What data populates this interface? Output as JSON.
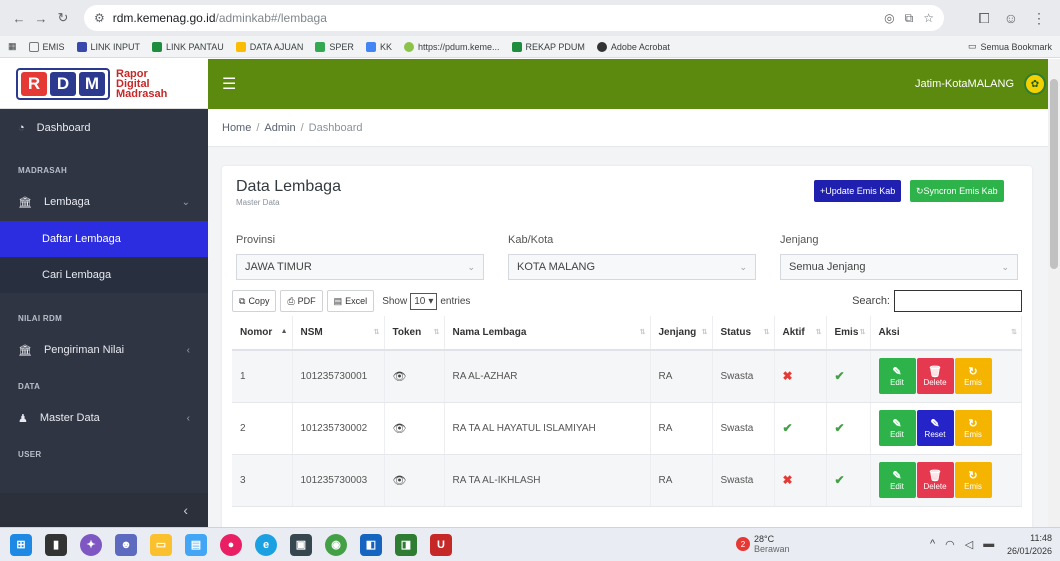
{
  "browser": {
    "url_host": "rdm.kemenag.go.id",
    "url_path": "/adminkab#/lembaga",
    "bookmarks": [
      "EMIS",
      "LINK INPUT",
      "LINK PANTAU",
      "DATA AJUAN",
      "SPER",
      "KK",
      "https://pdum.keme...",
      "REKAP PDUM",
      "Adobe Acrobat"
    ],
    "bookmarks_all": "Semua Bookmark"
  },
  "logo": {
    "line1": "Rapor",
    "line2": "Digital",
    "line3": "Madrasah",
    "mark": [
      "R",
      "D",
      "M"
    ]
  },
  "header": {
    "user": "Jatim-KotaMALANG"
  },
  "sidebar": {
    "dashboard": "Dashboard",
    "section_madrasah": "MADRASAH",
    "lembaga": "Lembaga",
    "daftar_lembaga": "Daftar Lembaga",
    "cari_lembaga": "Cari Lembaga",
    "section_nilai": "NILAI RDM",
    "pengiriman_nilai": "Pengiriman Nilai",
    "section_data": "DATA",
    "master_data": "Master Data",
    "section_user": "USER"
  },
  "breadcrumb": [
    "Home",
    "Admin",
    "Dashboard"
  ],
  "card": {
    "title": "Data Lembaga",
    "subtitle": "Master Data",
    "btn_update": "+Update Emis Kab",
    "btn_sync": "Syncron Emis Kab"
  },
  "filters": {
    "provinsi_label": "Provinsi",
    "provinsi_value": "JAWA TIMUR",
    "kab_label": "Kab/Kota",
    "kab_value": "KOTA MALANG",
    "jenjang_label": "Jenjang",
    "jenjang_value": "Semua Jenjang"
  },
  "datatable": {
    "copy": "Copy",
    "pdf": "PDF",
    "excel": "Excel",
    "show": "Show",
    "length": "10",
    "entries": "entries",
    "search": "Search:"
  },
  "table": {
    "headers": [
      "Nomor",
      "NSM",
      "Token",
      "Nama Lembaga",
      "Jenjang",
      "Status",
      "Aktif",
      "Emis",
      "Aksi"
    ],
    "rows": [
      {
        "no": "1",
        "nsm": "101235730001",
        "nama": "RA AL-AZHAR",
        "jenjang": "RA",
        "status": "Swasta",
        "aktif": "✖",
        "emis": "✔",
        "mid_label": "Delete"
      },
      {
        "no": "2",
        "nsm": "101235730002",
        "nama": "RA TA AL HAYATUL ISLAMIYAH",
        "jenjang": "RA",
        "status": "Swasta",
        "aktif": "✔",
        "emis": "✔",
        "mid_label": "Reset"
      },
      {
        "no": "3",
        "nsm": "101235730003",
        "nama": "RA TA AL-IKHLASH",
        "jenjang": "RA",
        "status": "Swasta",
        "aktif": "✖",
        "emis": "✔",
        "mid_label": "Delete"
      }
    ],
    "edit_label": "Edit",
    "emis_label": "Emis"
  },
  "taskbar": {
    "temp": "28°C",
    "weather": "Berawan",
    "weather_badge": "2",
    "time": "11:48",
    "date": "26/01/2026"
  }
}
